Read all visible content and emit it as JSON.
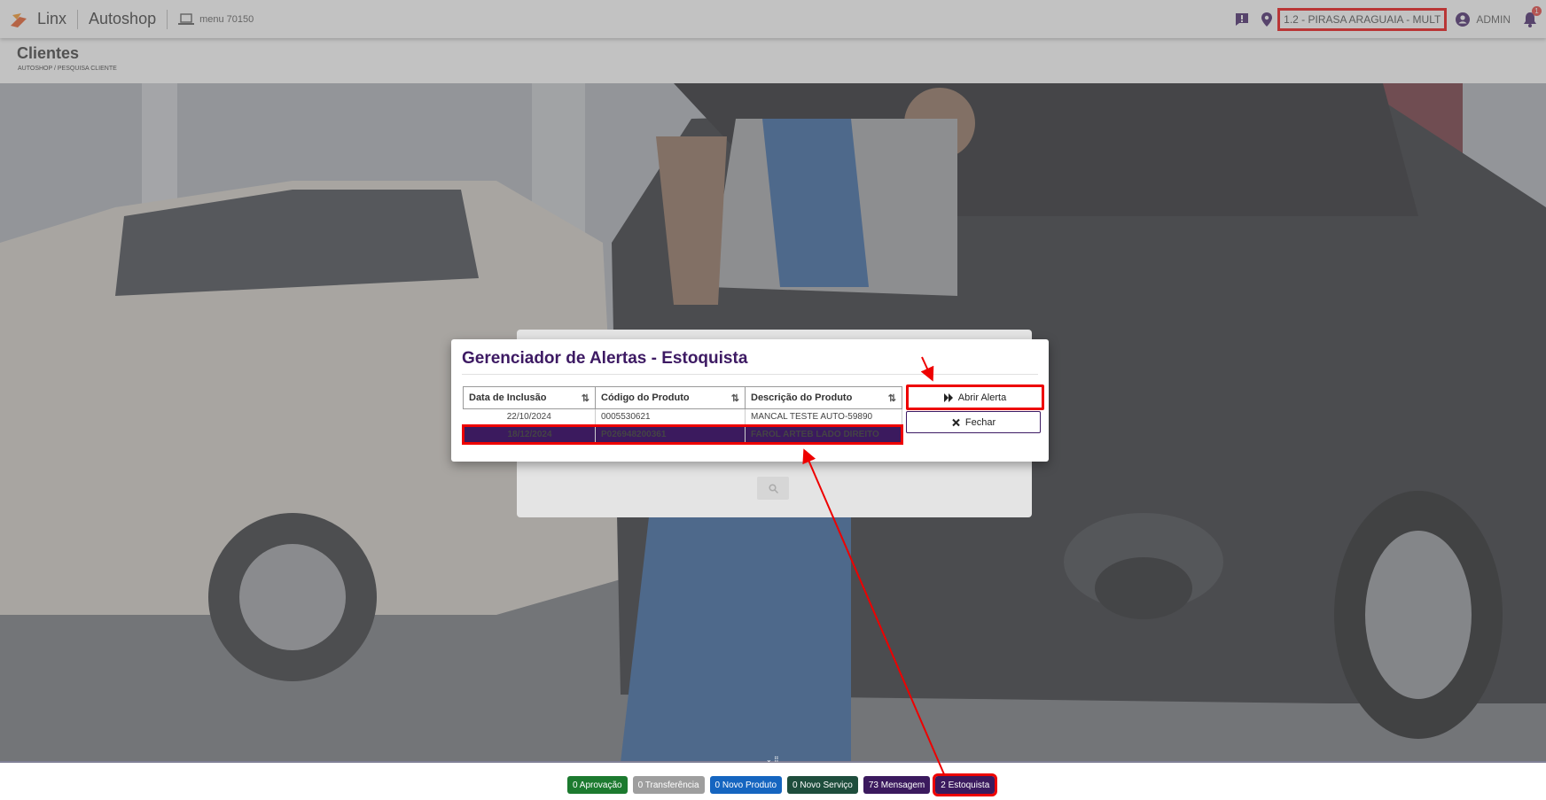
{
  "header": {
    "brand": "Linx",
    "product": "Autoshop",
    "menu_id": "menu 70150",
    "store": "1.2 - PIRASA ARAGUAIA - MULT",
    "user": "ADMIN",
    "notifications": "1"
  },
  "page": {
    "title": "Clientes",
    "breadcrumb": "AUTOSHOP / PESQUISA CLIENTE"
  },
  "modal": {
    "title": "Gerenciador de Alertas - Estoquista",
    "columns": [
      "Data de Inclusão",
      "Código do Produto",
      "Descrição do Produto"
    ],
    "rows": [
      {
        "date": "22/10/2024",
        "code": "0005530621",
        "desc": "MANCAL TESTE AUTO-59890"
      },
      {
        "date": "18/12/2024",
        "code": "P026948200361",
        "desc": "FAROL ARTEB LADO DIREITO"
      }
    ],
    "open_button": "Abrir Alerta",
    "close_button": "Fechar"
  },
  "footer": {
    "aprovacao": "0 Aprovação",
    "transferencia": "0 Transferência",
    "novo_produto": "0 Novo Produto",
    "novo_servico": "0 Novo Serviço",
    "mensagem": "73 Mensagem",
    "estoquista": "2 Estoquista"
  },
  "colors": {
    "accent": "#3d1a63",
    "highlight": "#e00000"
  },
  "icons": [
    "logo-icon",
    "laptop-icon",
    "chat-icon",
    "location-pin-icon",
    "user-icon",
    "bell-icon",
    "sort-icon",
    "fast-forward-icon",
    "close-icon",
    "search-icon"
  ]
}
